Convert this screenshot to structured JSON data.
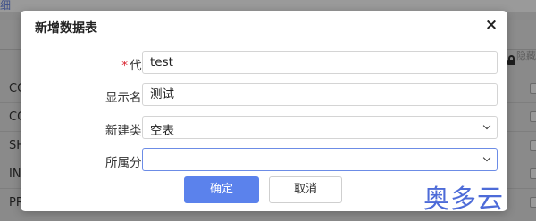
{
  "background": {
    "top_link": "细",
    "toolbar_right": "隐藏",
    "rows": [
      "CO",
      "CO",
      "SH",
      "IN",
      "PR"
    ]
  },
  "dialog": {
    "title": "新增数据表",
    "close_icon": "×",
    "fields": {
      "code": {
        "required_mark": "*",
        "label": "代码",
        "value": "test"
      },
      "display_name": {
        "label": "显示名称",
        "value": "测试"
      },
      "create_type": {
        "label": "新建类型",
        "selected": "空表",
        "icon": "chevron-down-icon"
      },
      "group": {
        "label": "所属分组",
        "selected": "",
        "icon": "chevron-down-icon"
      }
    },
    "buttons": {
      "ok": "确定",
      "cancel": "取消"
    }
  },
  "watermark": "奥多云",
  "colors": {
    "primary": "#5b82ec",
    "required": "#d9232f",
    "focus_border": "#6c8ce6"
  }
}
